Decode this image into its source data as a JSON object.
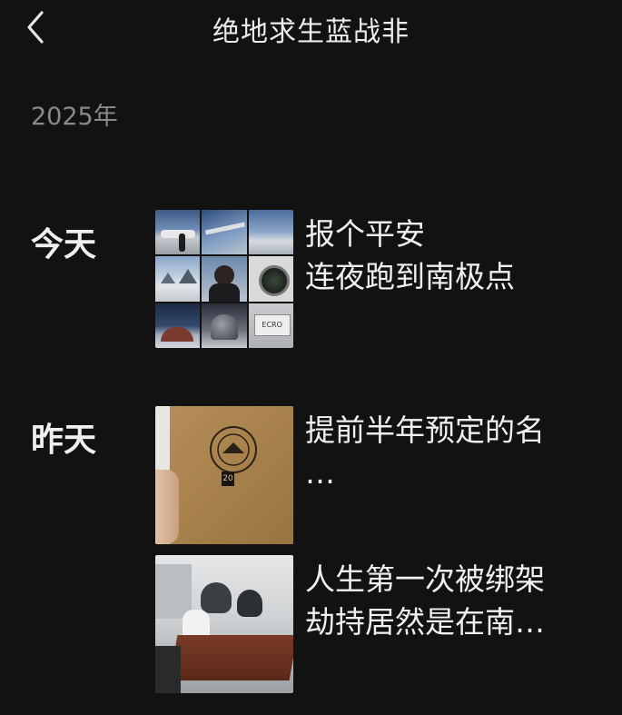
{
  "header": {
    "title": "绝地求生蓝战非",
    "back_icon": "chevron-left-icon"
  },
  "year_label": "2025年",
  "groups": [
    {
      "day": "今天",
      "posts": [
        {
          "lines": [
            "报个平安",
            "连夜跑到南极点"
          ],
          "thumbnail": "photo-grid-9"
        }
      ]
    },
    {
      "day": "昨天",
      "posts": [
        {
          "lines": [
            "提前半年预定的名",
            "…"
          ],
          "thumbnail": "book-photo",
          "badge_text": "20"
        },
        {
          "lines": [
            "人生第一次被绑架",
            "劫持居然是在南…"
          ],
          "thumbnail": "meeting-room-photo"
        }
      ]
    }
  ],
  "colors": {
    "background": "#121212",
    "text": "#f0f0f0",
    "muted": "#8a8a8a"
  }
}
